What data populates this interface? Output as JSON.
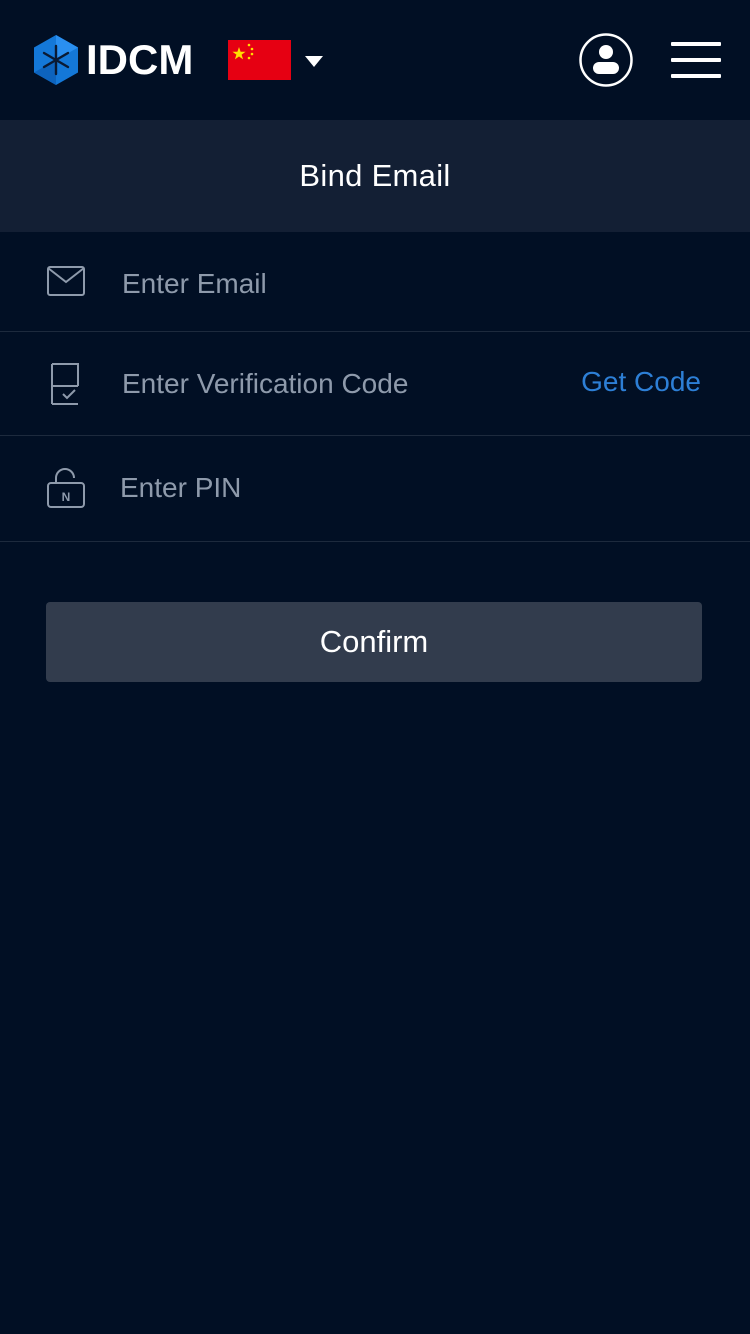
{
  "header": {
    "brand": "IDCM",
    "logo_icon": "idcm-logo-icon",
    "language_flag": "china-flag-icon",
    "language_dropdown_icon": "caret-down-icon",
    "user_icon": "user-circle-icon",
    "menu_icon": "hamburger-menu-icon"
  },
  "page": {
    "title": "Bind Email"
  },
  "form": {
    "email": {
      "icon": "envelope-icon",
      "placeholder": "Enter Email",
      "value": ""
    },
    "verification_code": {
      "icon": "document-check-icon",
      "placeholder": "Enter Verification Code",
      "value": "",
      "get_code_label": "Get Code"
    },
    "pin": {
      "icon": "unlocked-padlock-icon",
      "icon_letter": "N",
      "placeholder": "Enter PIN",
      "value": ""
    },
    "confirm_label": "Confirm"
  },
  "colors": {
    "background": "#010f24",
    "title_bar": "#131f34",
    "accent_link": "#2d7fd6",
    "button": "#323c4d",
    "placeholder": "#8e9aab",
    "divider": "#1d2a3d"
  }
}
